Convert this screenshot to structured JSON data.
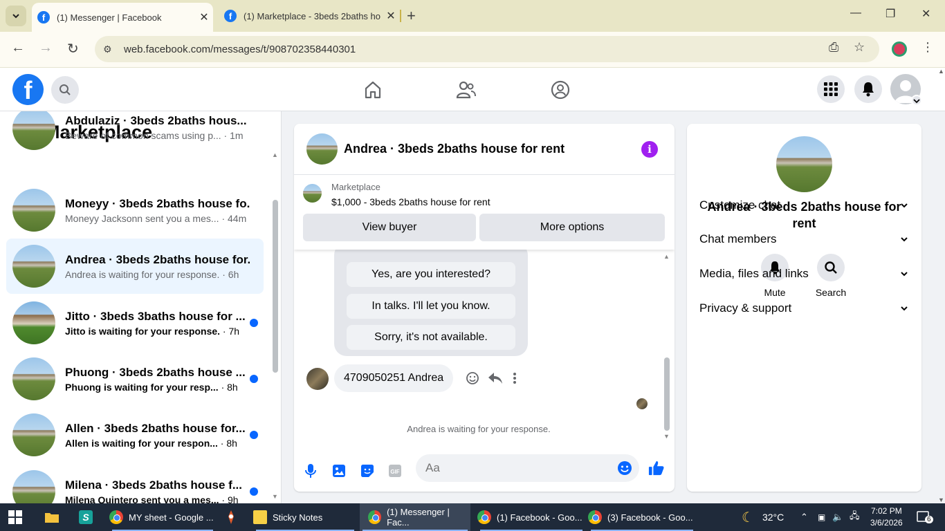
{
  "browser": {
    "tabs": [
      {
        "title": "(1) Messenger | Facebook",
        "active": true
      },
      {
        "title": "(1) Marketplace - 3beds 2baths ho",
        "active": false
      }
    ],
    "url": "web.facebook.com/messages/t/908702358440301"
  },
  "left_panel": {
    "title": "Marketplace",
    "conversations": [
      {
        "name": "Abdulaziz · 3beds 2baths hous...",
        "snippet": "Beware of common scams using p...",
        "time": " · 1m",
        "unread": false,
        "selected": false
      },
      {
        "name": "Moneyy · 3beds 2baths house fo...",
        "snippet": "Moneyy Jacksonn sent you a mes...",
        "time": " · 44m",
        "unread": false,
        "selected": false
      },
      {
        "name": "Andrea · 3beds 2baths house for...",
        "snippet": "Andrea is waiting for your response.",
        "time": " · 6h",
        "unread": false,
        "selected": true
      },
      {
        "name": "Jitto · 3beds 3baths house for ...",
        "snippet": "Jitto is waiting for your response.",
        "time": " · 7h",
        "unread": true,
        "selected": false
      },
      {
        "name": "Phuong · 3beds 2baths house ...",
        "snippet": "Phuong is waiting for your resp...",
        "time": " · 8h",
        "unread": true,
        "selected": false
      },
      {
        "name": "Allen · 3beds 2baths house for...",
        "snippet": "Allen is waiting for your respon...",
        "time": " · 8h",
        "unread": true,
        "selected": false
      },
      {
        "name": "Milena · 3beds 2baths house f...",
        "snippet": "Milena Quintero sent you a mes...",
        "time": " · 9h",
        "unread": true,
        "selected": false
      }
    ]
  },
  "chat": {
    "title": "Andrea · 3beds 2baths house for rent",
    "marketplace_label": "Marketplace",
    "listing": "$1,000 - 3beds 2baths house for rent",
    "view_buyer": "View buyer",
    "more_options": "More options",
    "quick_replies": [
      "Yes, are you interested?",
      "In talks. I'll let you know.",
      "Sorry, it's not available."
    ],
    "last_message": "4709050251 Andrea",
    "status": "Andrea is waiting for your response.",
    "input_placeholder": "Aa"
  },
  "right_panel": {
    "title": "Andrea · 3beds 2baths house for rent",
    "mute": "Mute",
    "search": "Search",
    "sections": [
      "Customize chat",
      "Chat members",
      "Media, files and links",
      "Privacy & support"
    ]
  },
  "taskbar": {
    "items": [
      "MY sheet - Google ...",
      "Sticky Notes",
      "(1) Messenger | Fac...",
      "(1) Facebook - Goo...",
      "(3) Facebook - Goo..."
    ],
    "temperature": "32°C",
    "time": "7:02 PM",
    "date": "3/6/2026",
    "notifications": "6"
  },
  "colors": {
    "fb_blue": "#1877f2",
    "unread_dot": "#0866ff",
    "selected_bg": "#ebf5ff",
    "info_purple": "#a020f0"
  }
}
